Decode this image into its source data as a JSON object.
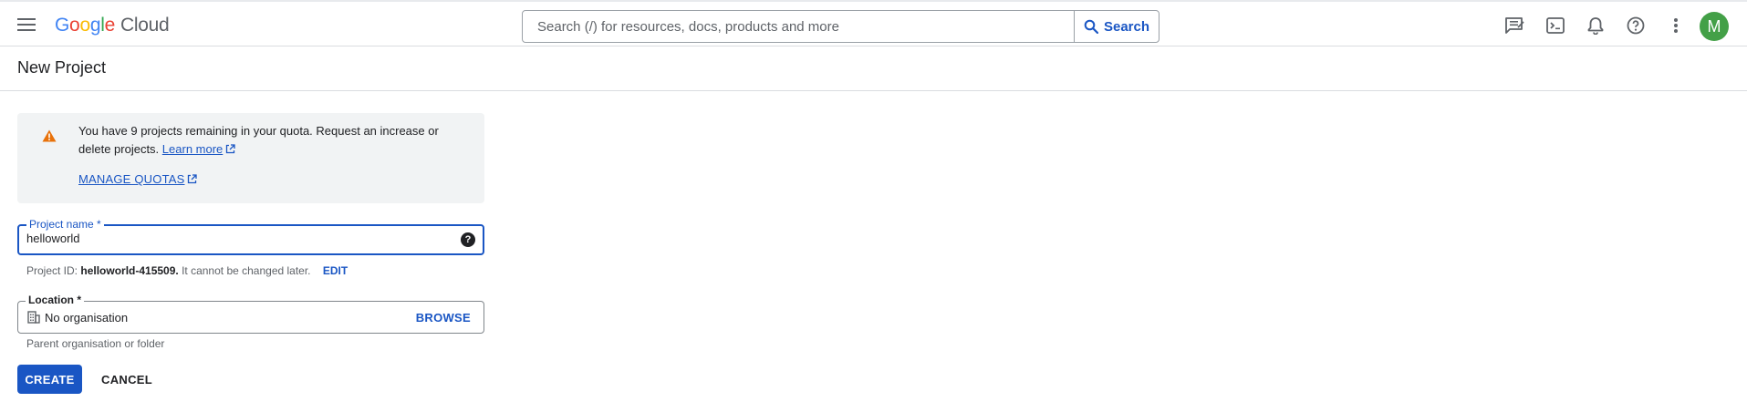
{
  "header": {
    "logo": {
      "word": [
        "G",
        "o",
        "o",
        "g",
        "l",
        "e"
      ],
      "colors": [
        "#4285f4",
        "#ea4335",
        "#fbbc05",
        "#4285f4",
        "#34a853",
        "#ea4335"
      ],
      "product": "Cloud"
    },
    "search": {
      "placeholder": "Search (/) for resources, docs, products and more",
      "button_label": "Search"
    },
    "icons": [
      "menu-icon",
      "search-icon",
      "feedback-icon",
      "cloud-shell-icon",
      "notifications-icon",
      "help-icon",
      "more-vert-icon"
    ],
    "avatar_initial": "M",
    "avatar_color": "#43a047"
  },
  "page": {
    "title": "New Project"
  },
  "alert": {
    "message": "You have 9 projects remaining in your quota. Request an increase or delete projects.",
    "learn_more": "Learn more",
    "manage_quotas": "MANAGE QUOTAS",
    "icon": "warning-icon",
    "icon_color": "#e8710a"
  },
  "form": {
    "project_name": {
      "label": "Project name *",
      "value": "helloworld"
    },
    "project_id": {
      "prefix": "Project ID:",
      "value": "helloworld-415509.",
      "suffix": "It cannot be changed later.",
      "edit_label": "EDIT"
    },
    "location": {
      "label": "Location *",
      "value": "No organisation",
      "browse_label": "BROWSE",
      "hint": "Parent organisation or folder"
    }
  },
  "actions": {
    "create_label": "CREATE",
    "cancel_label": "CANCEL"
  },
  "colors": {
    "accent": "#1a56c4",
    "alert_bg": "#f1f3f4",
    "border": "#dadce0"
  }
}
